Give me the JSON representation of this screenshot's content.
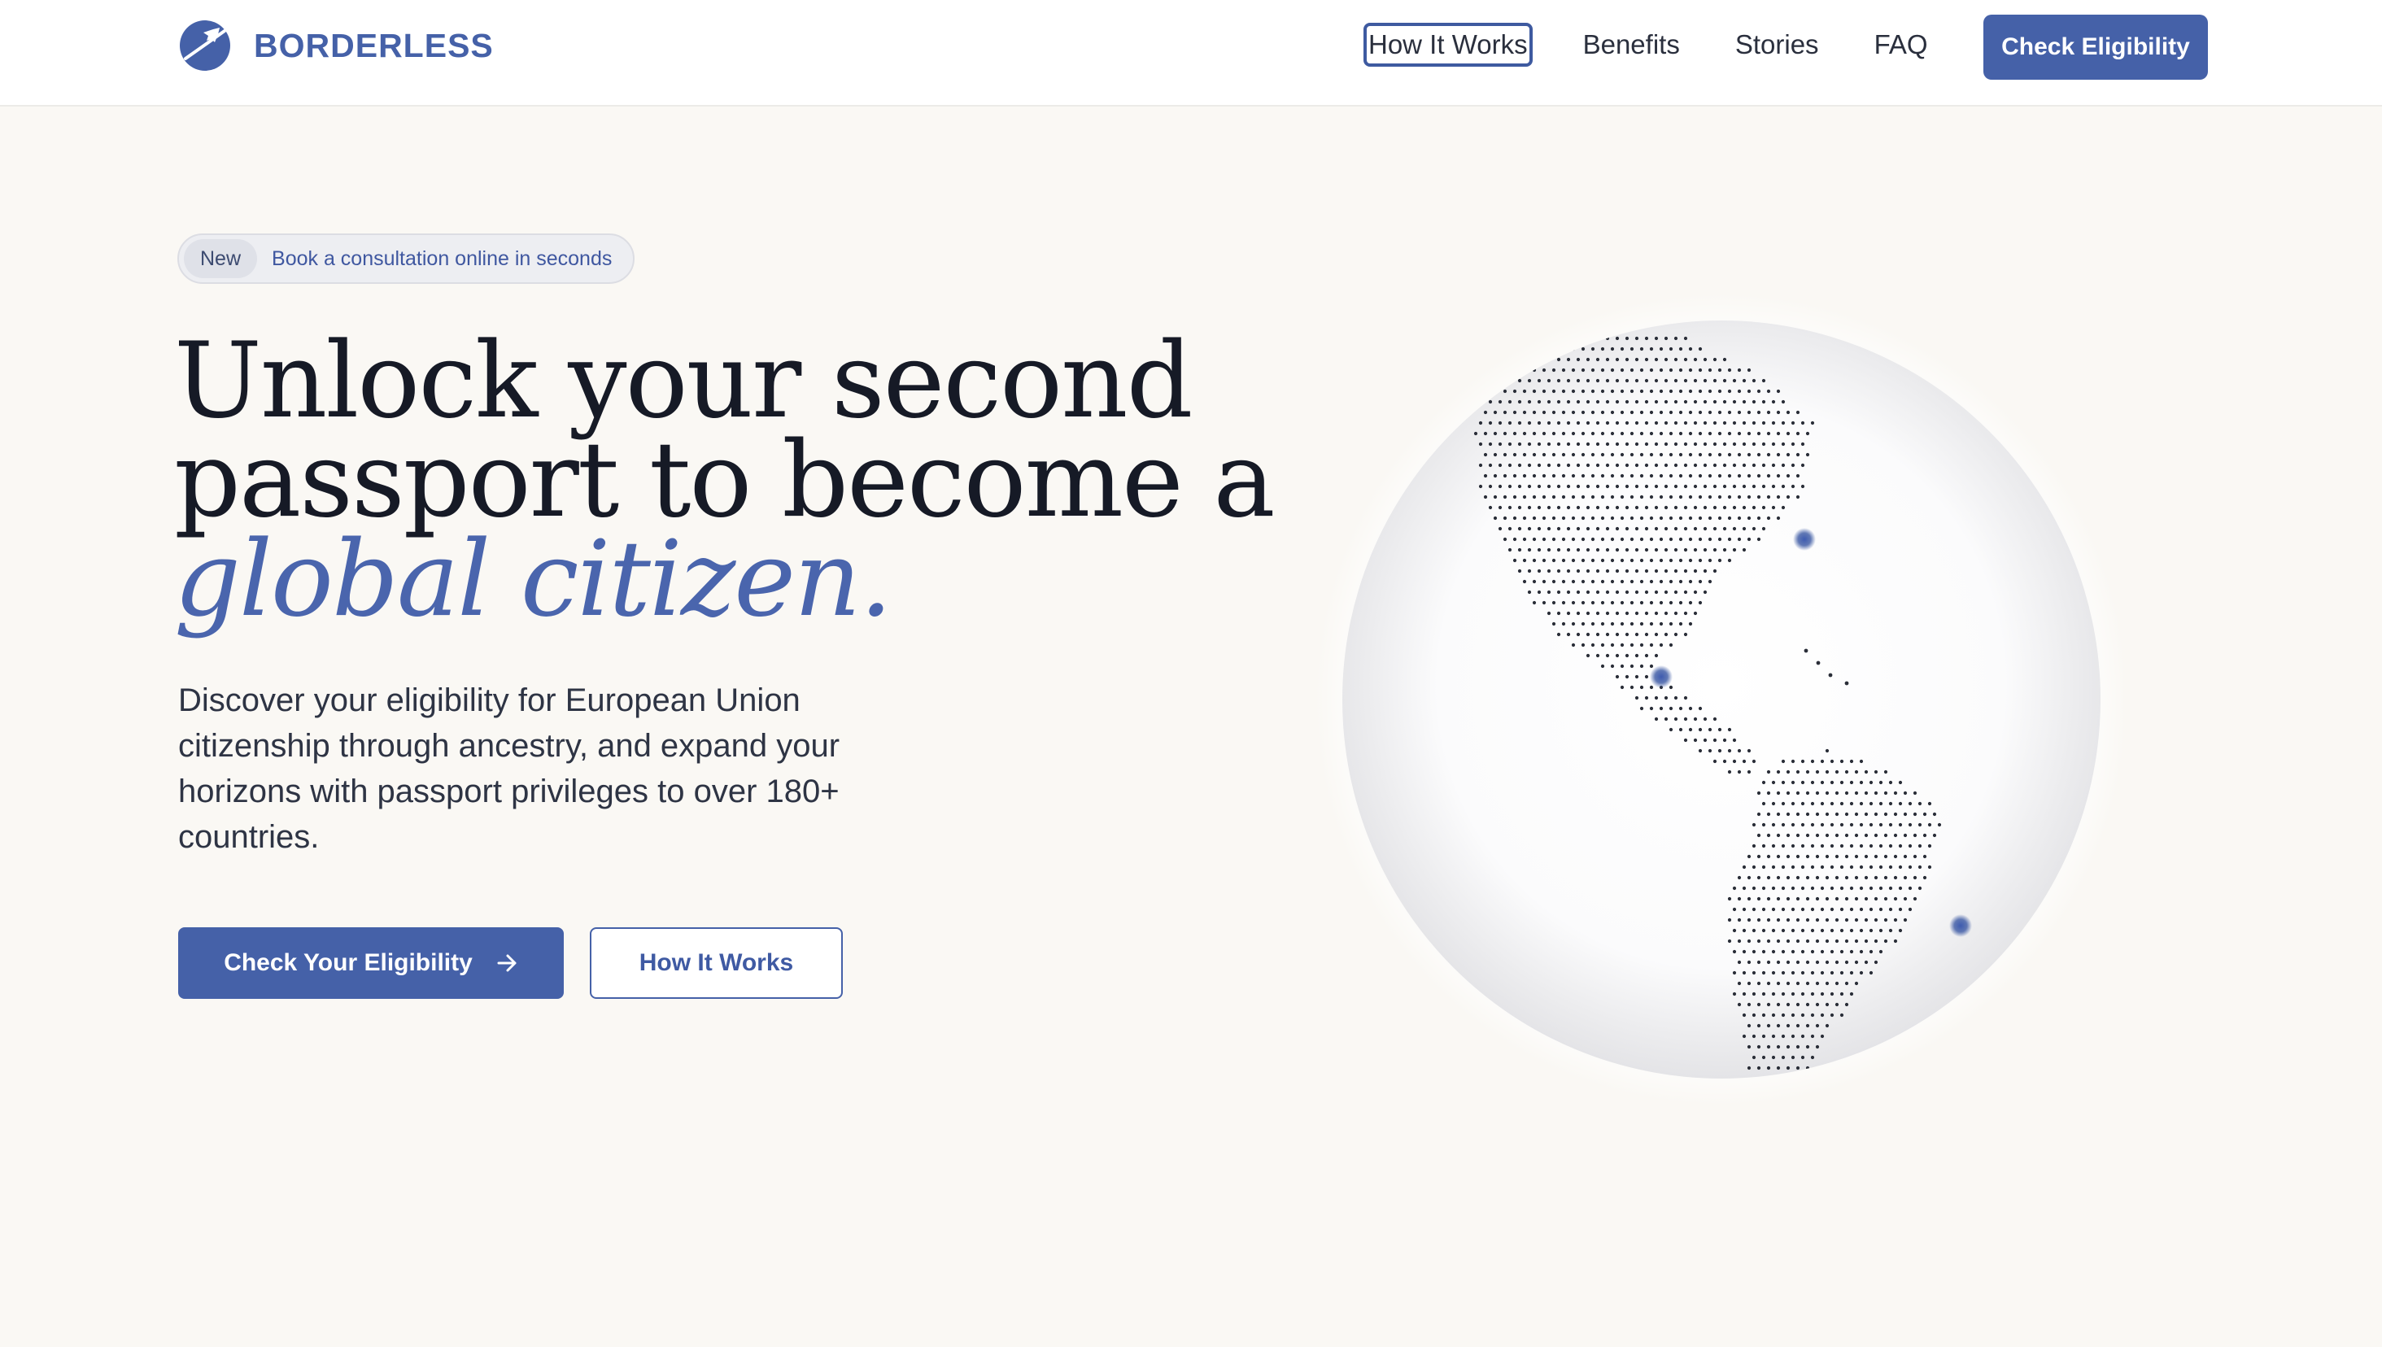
{
  "brand": {
    "name": "BORDERLESS",
    "accent_color": "#4561a8"
  },
  "nav": {
    "links": [
      {
        "label": "How It Works"
      },
      {
        "label": "Benefits"
      },
      {
        "label": "Stories"
      },
      {
        "label": "FAQ"
      }
    ],
    "cta_label": "Check Eligibility"
  },
  "hero": {
    "badge_tag": "New",
    "badge_text": "Book a consultation online in seconds",
    "headline_line1": "Unlock your second",
    "headline_line2": "passport to become a",
    "headline_accent": "global citizen.",
    "lede": "Discover your eligibility for European Union citizenship through ancestry, and expand your horizons with passport privileges to over 180+ countries.",
    "primary_cta": "Check Your Eligibility",
    "secondary_cta": "How It Works"
  },
  "icons": {
    "logo": "plane-globe-icon",
    "primary_cta_icon": "arrow-right-icon"
  }
}
